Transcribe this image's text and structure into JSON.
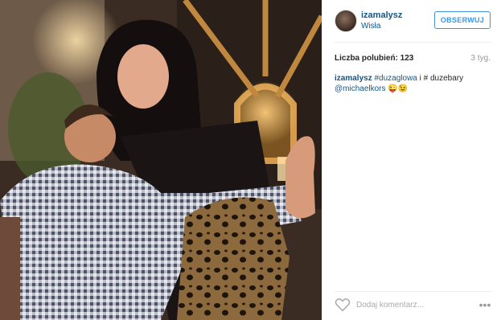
{
  "header": {
    "username": "izamalysz",
    "location": "Wisła",
    "follow_label": "OBSERWUJ"
  },
  "likes_label": "Liczba polubień: 123",
  "time": "3 tyg.",
  "caption": {
    "username": "izamalysz",
    "tag1": "#duzaglowa",
    "text1": " i # duzebary",
    "mention": "@michaelkors",
    "emoji": " 😜😉"
  },
  "footer": {
    "comment_placeholder": "Dodaj komentarz...",
    "more": "•••"
  },
  "colors": {
    "link": "#125688",
    "follow": "#3897f0"
  },
  "icons": {
    "like": "heart-outline-icon",
    "options": "more-horizontal-icon"
  }
}
